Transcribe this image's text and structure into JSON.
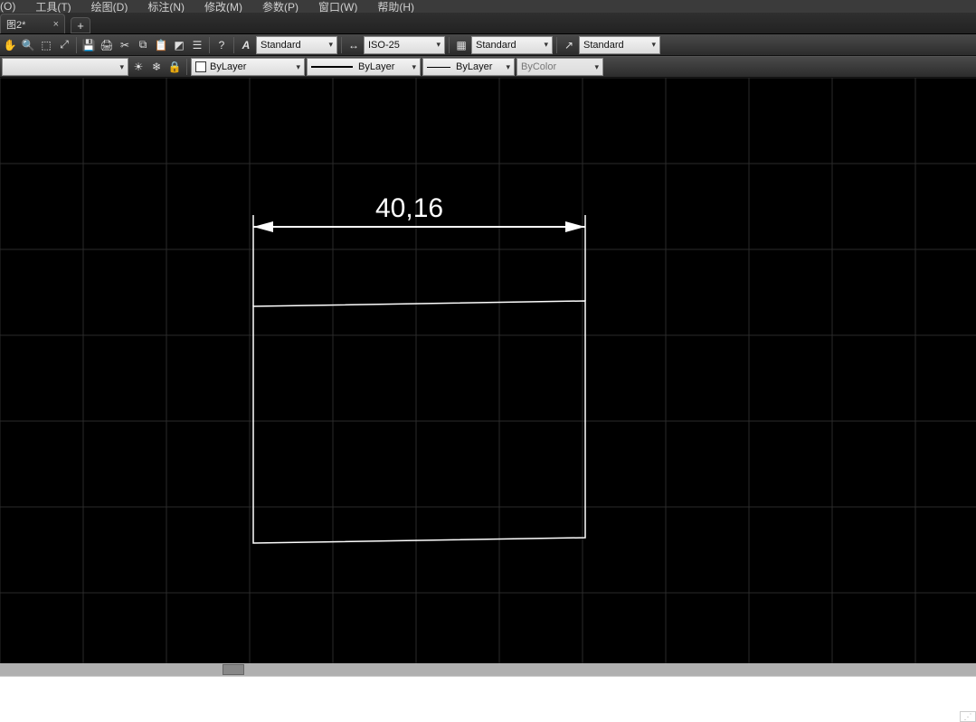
{
  "menu": {
    "items": [
      "(O)",
      "工具(T)",
      "绘图(D)",
      "标注(N)",
      "修改(M)",
      "参数(P)",
      "窗口(W)",
      "帮助(H)"
    ]
  },
  "tabs": {
    "active_label": "图2*",
    "close_label": "×",
    "new_label": "+"
  },
  "toolbar1": {
    "text_style": "Standard",
    "dim_style": "ISO-25",
    "table_style": "Standard",
    "mleader_style": "Standard"
  },
  "toolbar2": {
    "layer_color_label": "ByLayer",
    "linetype_label": "ByLayer",
    "lineweight_label": "ByLayer",
    "plot_style_label": "ByColor"
  },
  "drawing": {
    "dimension_value": "40,16"
  }
}
